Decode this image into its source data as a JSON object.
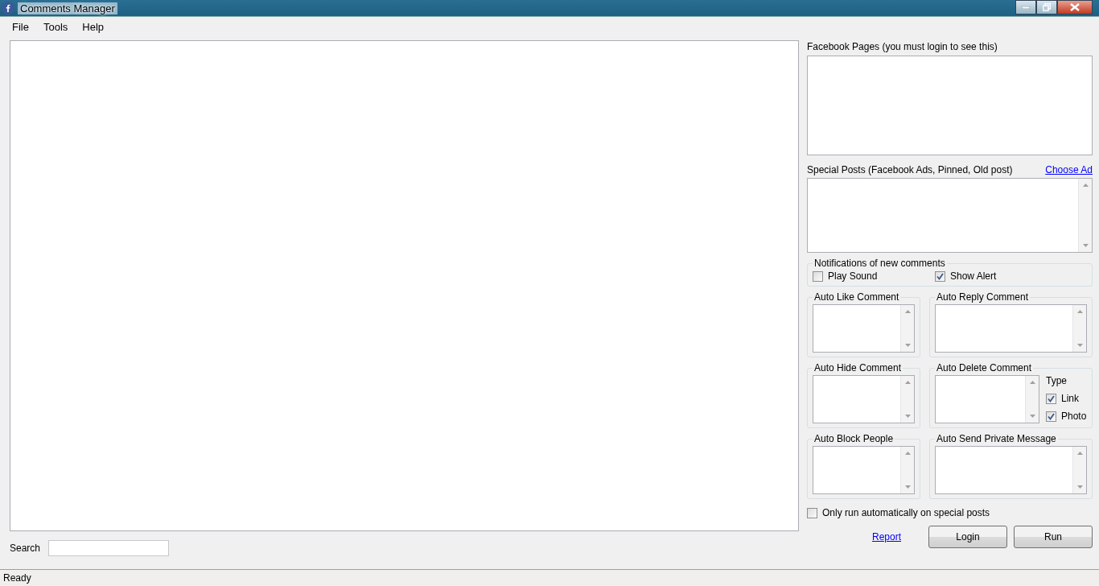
{
  "window": {
    "title": "Comments Manager"
  },
  "menu": [
    "File",
    "Tools",
    "Help"
  ],
  "search": {
    "label": "Search"
  },
  "pages": {
    "label": "Facebook Pages (you must login to see this)"
  },
  "special_posts": {
    "label": "Special Posts (Facebook Ads, Pinned, Old post)",
    "link": "Choose Ad"
  },
  "notifications": {
    "title": "Notifications of new comments",
    "options": [
      {
        "label": "Play Sound",
        "checked": false
      },
      {
        "label": "Show Alert",
        "checked": true
      }
    ]
  },
  "groups": [
    {
      "title": "Auto Like Comment"
    },
    {
      "title": "Auto Reply Comment"
    },
    {
      "title": "Auto Hide Comment"
    },
    {
      "title": "Auto Delete Comment",
      "type_label": "Type",
      "types": [
        {
          "label": "Link",
          "checked": true
        },
        {
          "label": "Photo",
          "checked": true
        }
      ]
    },
    {
      "title": "Auto Block People"
    },
    {
      "title": "Auto Send Private Message"
    }
  ],
  "only_special": {
    "label": "Only run automatically on special posts",
    "checked": false
  },
  "report_link": "Report",
  "buttons": [
    "Login",
    "Run"
  ],
  "status_bar": "Ready"
}
